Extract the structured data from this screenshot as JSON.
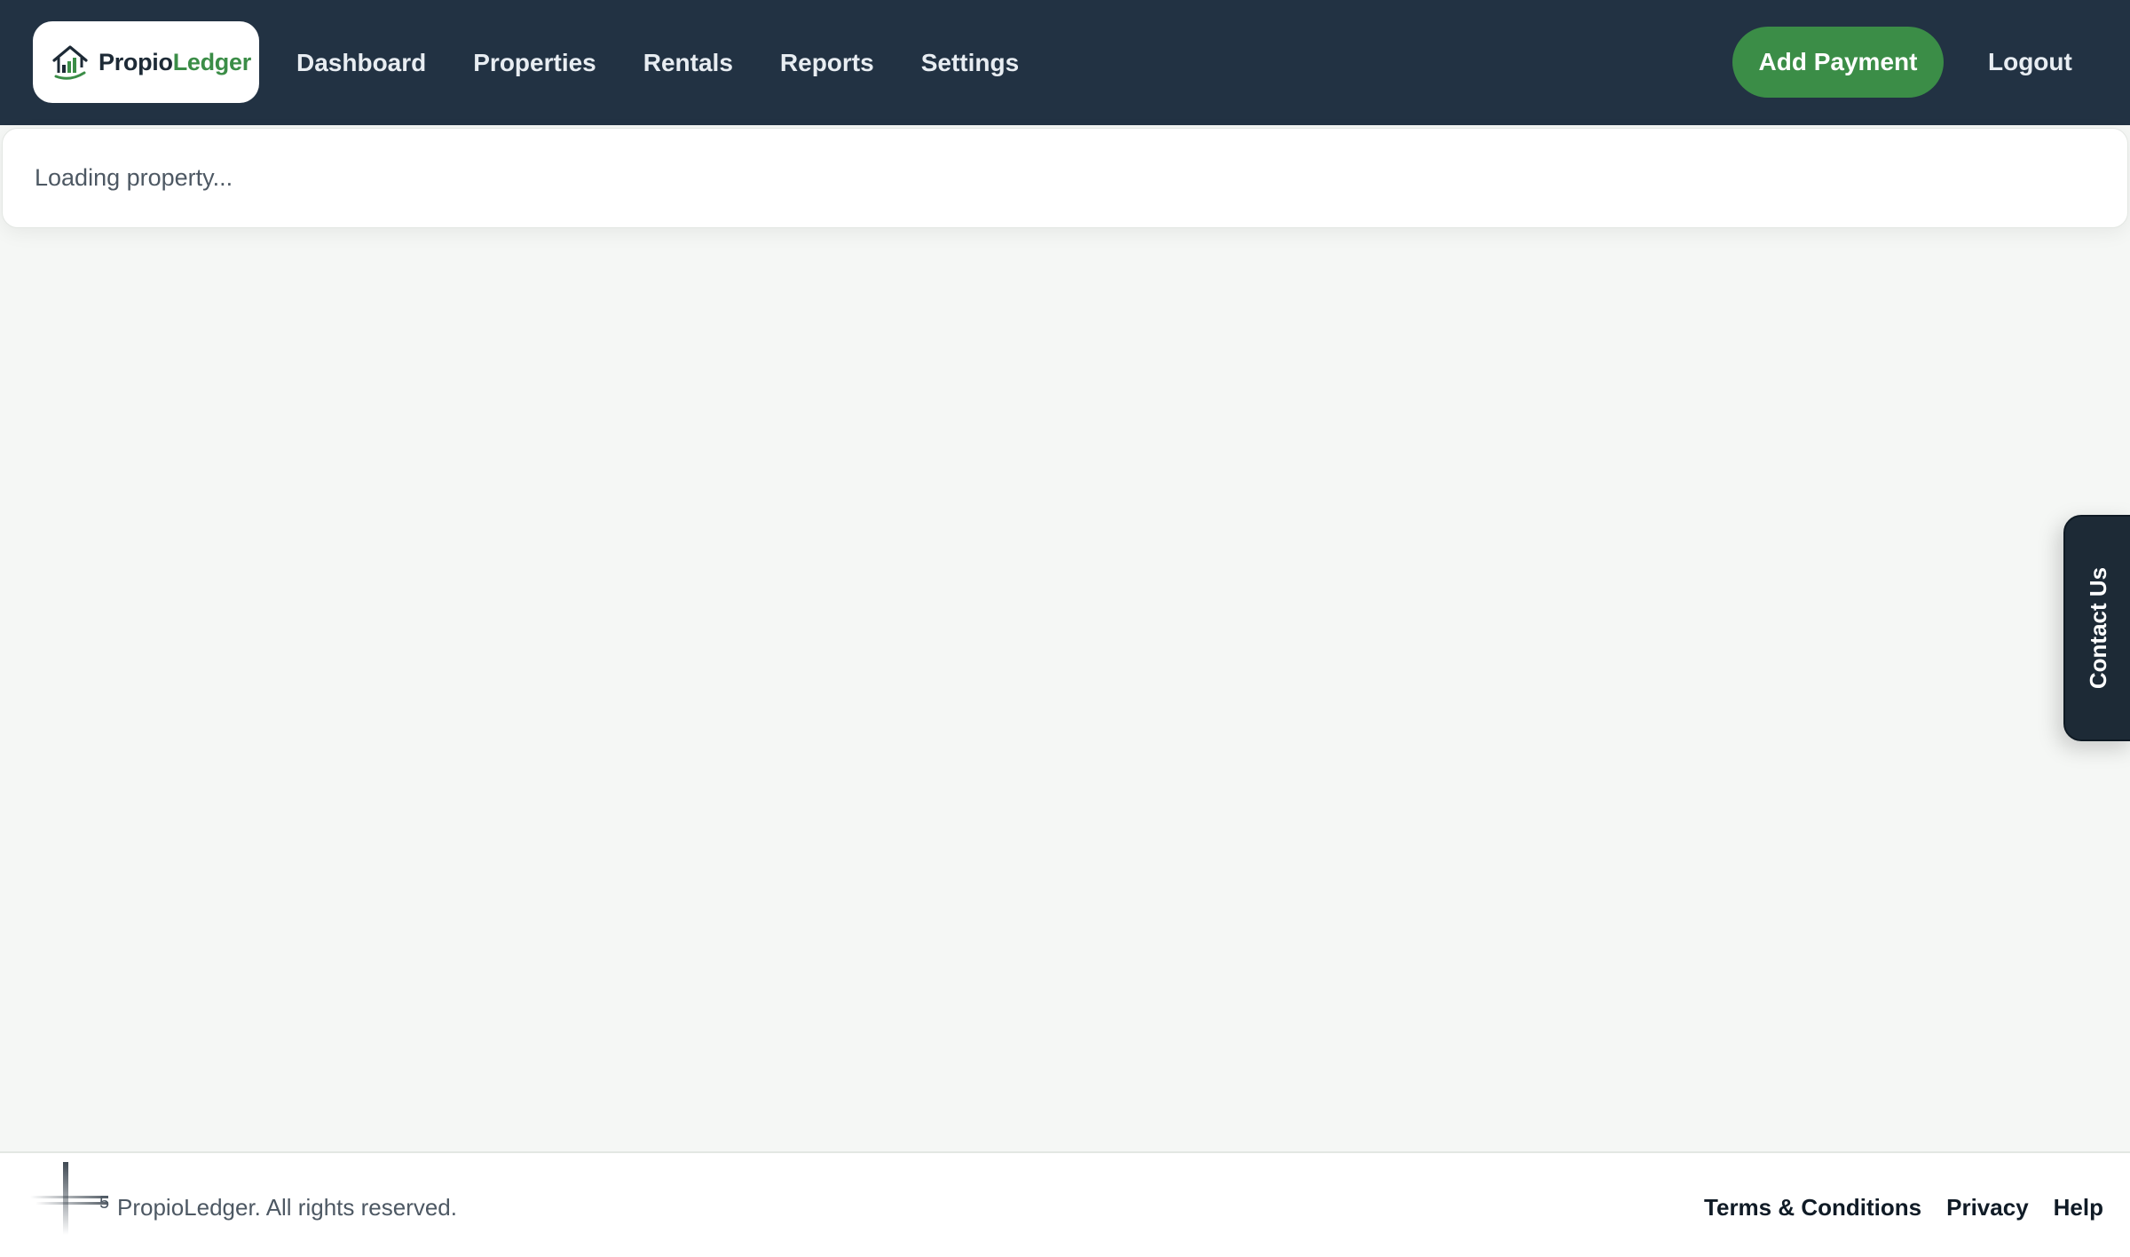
{
  "brand": {
    "name_part1": "Propio",
    "name_part2": "Ledger",
    "logo_icon": "house-chart-icon"
  },
  "nav": {
    "items": [
      {
        "label": "Dashboard"
      },
      {
        "label": "Properties"
      },
      {
        "label": "Rentals"
      },
      {
        "label": "Reports"
      },
      {
        "label": "Settings"
      }
    ],
    "add_payment_label": "Add Payment",
    "logout_label": "Logout"
  },
  "main": {
    "loading_text": "Loading property..."
  },
  "contact_tab": {
    "label": "Contact Us"
  },
  "footer": {
    "copyright": "PropioLedger. All rights reserved.",
    "links": [
      {
        "label": "Terms & Conditions"
      },
      {
        "label": "Privacy"
      },
      {
        "label": "Help"
      }
    ]
  },
  "colors": {
    "header_bg": "#223243",
    "accent_green": "#3b8d47",
    "page_bg": "#f5f7f5",
    "dark_tab": "#1d2a36"
  }
}
